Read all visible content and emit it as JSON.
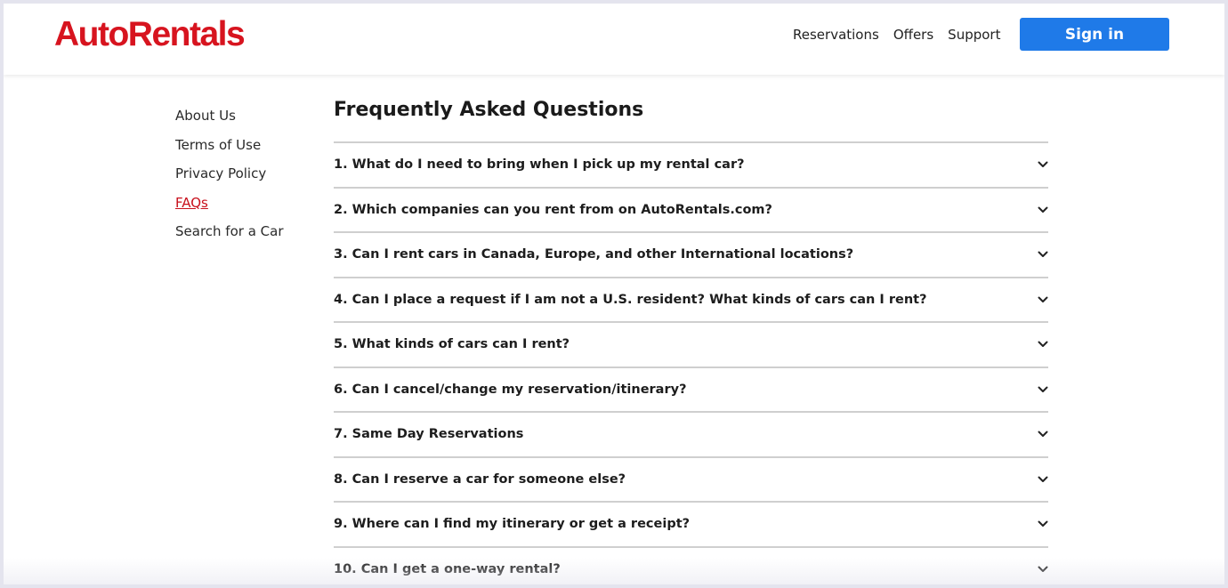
{
  "brand": {
    "logo_text": "AutoRentals",
    "color": "#d7141f"
  },
  "header": {
    "nav": [
      "Reservations",
      "Offers",
      "Support"
    ],
    "signin_label": "Sign in",
    "signin_color": "#1f7ae8"
  },
  "sidebar": {
    "items": [
      {
        "label": "About Us",
        "active": false
      },
      {
        "label": "Terms of Use",
        "active": false
      },
      {
        "label": "Privacy Policy",
        "active": false
      },
      {
        "label": "FAQs",
        "active": true
      },
      {
        "label": "Search for a Car",
        "active": false
      }
    ]
  },
  "main": {
    "title": "Frequently Asked Questions",
    "faqs": [
      "1. What do I need to bring when I pick up my rental car?",
      "2. Which companies can you rent from on AutoRentals.com?",
      "3. Can I rent cars in Canada, Europe, and other International locations?",
      "4. Can I place a request if I am not a U.S. resident? What kinds of cars can I rent?",
      "5. What kinds of cars can I rent?",
      "6. Can I cancel/change my reservation/itinerary?",
      "7. Same Day Reservations",
      "8. Can I reserve a car for someone else?",
      "9. Where can I find my itinerary or get a receipt?",
      "10. Can I get a one-way rental?"
    ],
    "expand_icon": "chevron-down-icon"
  }
}
